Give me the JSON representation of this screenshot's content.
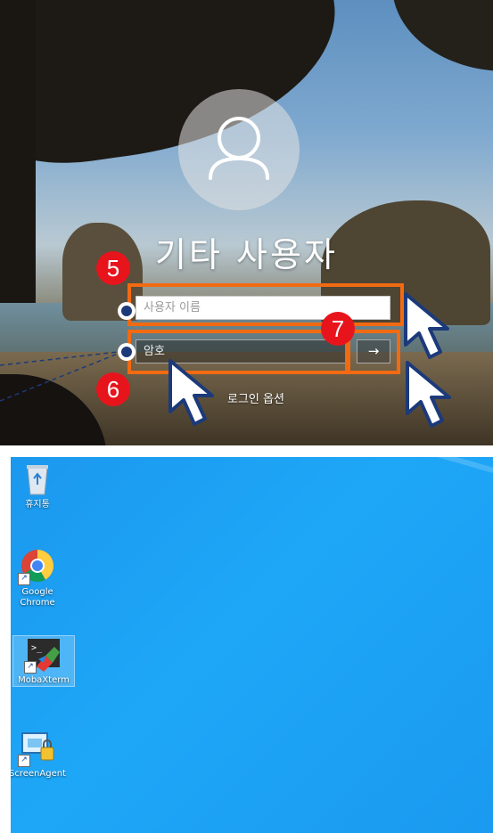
{
  "login": {
    "user_name": "기타 사용자",
    "username_placeholder": "사용자 이름",
    "password_placeholder": "암호",
    "submit_arrow": "→",
    "signin_options": "로그인 옵션"
  },
  "annotations": {
    "step5": "5",
    "step6": "6",
    "step7": "7",
    "highlight_color": "#f26a12",
    "badge_color": "#e8141c"
  },
  "desktop": {
    "icons": [
      {
        "label": "휴지통",
        "icon": "recycle-bin-icon"
      },
      {
        "label": "Google Chrome",
        "icon": "chrome-icon"
      },
      {
        "label": "MobaXterm",
        "icon": "mobaxterm-icon"
      },
      {
        "label": "ScreenAgent",
        "icon": "screenagent-icon"
      }
    ],
    "background_color": "#1ea7f7"
  }
}
